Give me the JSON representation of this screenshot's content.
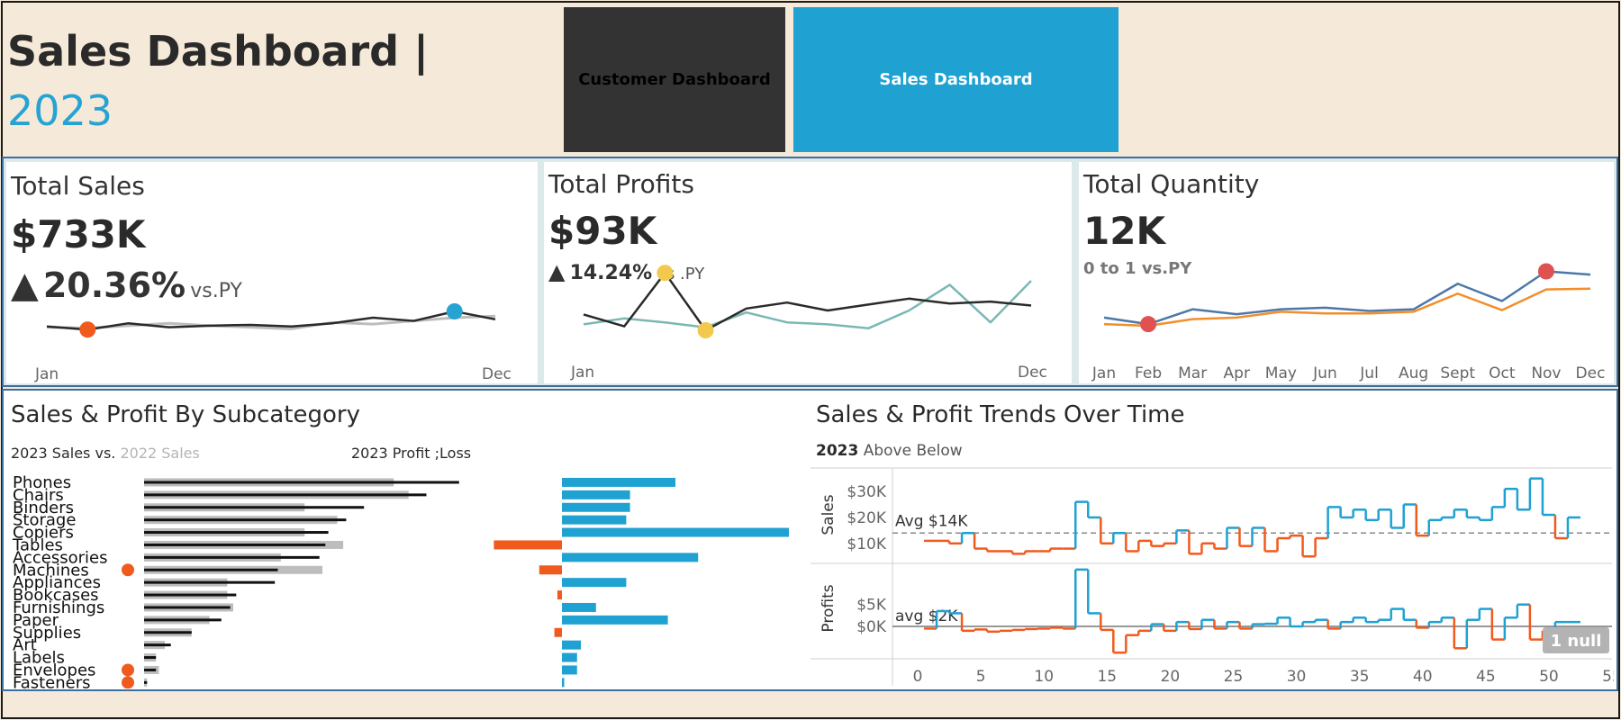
{
  "header": {
    "title": "Sales Dashboard |",
    "year": "2023"
  },
  "nav": {
    "customer_label": "Customer Dashboard",
    "sales_label": "Sales Dashboard"
  },
  "colors": {
    "accent_blue": "#1fa1d2",
    "loss_orange": "#f15a1d",
    "dark": "#2a2a2a",
    "py_grey": "#bdbdbd",
    "teal": "#7ab8b4",
    "gold": "#f2c94c",
    "kpi3_blue": "#4c78a8",
    "kpi3_orange": "#f28e2b",
    "red_marker": "#e05252"
  },
  "kpis": {
    "sales": {
      "title": "Total Sales",
      "value": "$733K",
      "arrow": "▲",
      "delta": "20.36%",
      "delta_suffix": "vs.PY",
      "x_start": "Jan",
      "x_end": "Dec"
    },
    "profits": {
      "title": "Total Profits",
      "value": "$93K",
      "arrow": "▲",
      "delta": "14.24%",
      "delta_suffix": "vs .PY",
      "x_start": "Jan",
      "x_end": "Dec"
    },
    "quantity": {
      "title": "Total Quantity",
      "value": "12K",
      "delta_text": "0 to 1 vs.PY"
    }
  },
  "chart_data": [
    {
      "type": "line",
      "id": "sales_sparkline",
      "x": [
        "Jan",
        "Feb",
        "Mar",
        "Apr",
        "May",
        "Jun",
        "Jul",
        "Aug",
        "Sep",
        "Oct",
        "Nov",
        "Dec"
      ],
      "series": [
        {
          "values": [
            31,
            27,
            35,
            30,
            32,
            33,
            31,
            35,
            42,
            38,
            50,
            40
          ]
        },
        {
          "values": [
            30,
            29,
            32,
            35,
            32,
            30,
            28,
            36,
            34,
            38,
            42,
            44
          ]
        }
      ],
      "ylim": [
        0,
        100
      ],
      "x_start": "Jan",
      "x_end": "Dec",
      "markers": [
        {
          "series": 0,
          "index": 1,
          "color": "#f15a1d"
        },
        {
          "series": 0,
          "index": 10,
          "color": "#27a3d3"
        }
      ]
    },
    {
      "type": "line",
      "id": "profit_sparkline",
      "x": [
        "Jan",
        "Feb",
        "Mar",
        "Apr",
        "May",
        "Jun",
        "Jul",
        "Aug",
        "Sep",
        "Oct",
        "Nov",
        "Dec"
      ],
      "series": [
        {
          "values": [
            4.6,
            3.4,
            8.8,
            3.0,
            5.2,
            5.8,
            5.0,
            5.6,
            6.2,
            5.7,
            5.9,
            5.5
          ]
        },
        {
          "values": [
            3.6,
            4.2,
            3.8,
            3.3,
            4.8,
            3.8,
            3.6,
            3.2,
            5.0,
            7.6,
            3.8,
            8.0
          ]
        }
      ],
      "ylim": [
        0,
        10
      ],
      "x_start": "Jan",
      "x_end": "Dec",
      "markers": [
        {
          "series": 0,
          "index": 2,
          "color": "#f2c94c"
        },
        {
          "series": 0,
          "index": 3,
          "color": "#f2c94c"
        }
      ]
    },
    {
      "type": "line",
      "id": "quantity_sparkline",
      "x": [
        "Jan",
        "Feb",
        "Mar",
        "Apr",
        "May",
        "Jun",
        "Jul",
        "Aug",
        "Sept",
        "Oct",
        "Nov",
        "Dec"
      ],
      "series": [
        {
          "values": [
            760,
            680,
            860,
            800,
            860,
            880,
            840,
            860,
            1170,
            960,
            1320,
            1280
          ]
        },
        {
          "values": [
            680,
            660,
            740,
            760,
            830,
            810,
            810,
            830,
            1050,
            850,
            1100,
            1110
          ]
        }
      ],
      "ylim": [
        300,
        1500
      ],
      "markers": [
        {
          "series": 0,
          "index": 1,
          "color": "#e05252"
        },
        {
          "series": 0,
          "index": 10,
          "color": "#e05252"
        }
      ]
    },
    {
      "type": "bar",
      "id": "subcategory_sales_profit",
      "title": "Sales & Profit By Subcategory",
      "legend_sales_2023": "2023 Sales vs.",
      "legend_sales_2022": "2022 Sales",
      "legend_profit": "2023  Profit  ;Loss",
      "categories": [
        "Phones",
        "Chairs",
        "Binders",
        "Storage",
        "Copiers",
        "Tables",
        "Accessories",
        "Machines",
        "Appliances",
        "Bookcases",
        "Furnishings",
        "Paper",
        "Supplies",
        "Art",
        "Labels",
        "Envelopes",
        "Fasteners"
      ],
      "series": [
        {
          "values": [
            106,
            95,
            74,
            68,
            62,
            61,
            59,
            45,
            44,
            31,
            29,
            26,
            16,
            9,
            4,
            4,
            1
          ]
        },
        {
          "values": [
            84,
            89,
            54,
            65,
            54,
            67,
            46,
            60,
            28,
            28,
            30,
            22,
            16,
            7,
            4,
            5,
            1
          ]
        },
        {
          "values": [
            15,
            9,
            9,
            8.5,
            30,
            -9,
            18,
            -3,
            8.5,
            -0.6,
            4.5,
            14,
            -1,
            2.5,
            2,
            2,
            0.3
          ]
        }
      ],
      "markers": [
        "Machines",
        "Envelopes",
        "Fasteners"
      ]
    },
    {
      "type": "line",
      "id": "weekly_trends",
      "title": "Sales & Profit Trends Over Time",
      "legend_prefix": "2023",
      "legend_above": "Above",
      "legend_below": "Below",
      "x": [
        1,
        2,
        3,
        4,
        5,
        6,
        7,
        8,
        9,
        10,
        11,
        12,
        13,
        14,
        15,
        16,
        17,
        18,
        19,
        20,
        21,
        22,
        23,
        24,
        25,
        26,
        27,
        28,
        29,
        30,
        31,
        32,
        33,
        34,
        35,
        36,
        37,
        38,
        39,
        40,
        41,
        42,
        43,
        44,
        45,
        46,
        47,
        48,
        49,
        50,
        51,
        52
      ],
      "series": [
        {
          "name": "Sales",
          "values": [
            11,
            11,
            10,
            14,
            8,
            7,
            7,
            6,
            7,
            7,
            8,
            8,
            26,
            20,
            10,
            14,
            7,
            11,
            9,
            10,
            15,
            6,
            10,
            8,
            16,
            9,
            16,
            7,
            12,
            13,
            5,
            12,
            24,
            20,
            23,
            19,
            23,
            16,
            25,
            13,
            19,
            20,
            23,
            20,
            19,
            24,
            31,
            23,
            35,
            21,
            12,
            20
          ]
        },
        {
          "name": "Profits",
          "values": [
            -0.5,
            3.5,
            3,
            -1,
            -0.7,
            -1.2,
            -1,
            -0.8,
            -0.6,
            -0.5,
            -0.3,
            -0.5,
            13,
            3,
            -0.8,
            -6,
            -2,
            -1,
            0.5,
            -1,
            1,
            -0.6,
            1.5,
            -0.5,
            1,
            -0.5,
            0.5,
            0.6,
            2,
            0,
            1,
            1.5,
            -0.5,
            1,
            2,
            1,
            1.5,
            4,
            1.5,
            -0.3,
            1,
            2,
            -5,
            1.5,
            4,
            -3,
            2,
            5,
            -3,
            -1,
            1,
            1
          ]
        }
      ],
      "y1_label": "Sales",
      "y1_ticks": [
        "$30K",
        "$20K",
        "$10K"
      ],
      "y1_ticks_values": [
        30,
        20,
        10
      ],
      "y1_range": [
        3,
        38
      ],
      "y1_avg": 14,
      "y1_avg_label": "Avg $14K",
      "y2_label": "Profits",
      "y2_ticks": [
        "$5K",
        "$0K"
      ],
      "y2_ticks_values": [
        5,
        0
      ],
      "y2_range": [
        -7,
        14
      ],
      "y2_avg": 0,
      "y2_avg_label": "avg $2K",
      "x_ticks": [
        "0",
        "5",
        "10",
        "15",
        "20",
        "25",
        "30",
        "35",
        "40",
        "45",
        "50",
        "55"
      ],
      "x_ticks_values": [
        0,
        5,
        10,
        15,
        20,
        25,
        30,
        35,
        40,
        45,
        50,
        55
      ],
      "x_range": [
        -2,
        55
      ],
      "null_badge": "1 null"
    }
  ]
}
